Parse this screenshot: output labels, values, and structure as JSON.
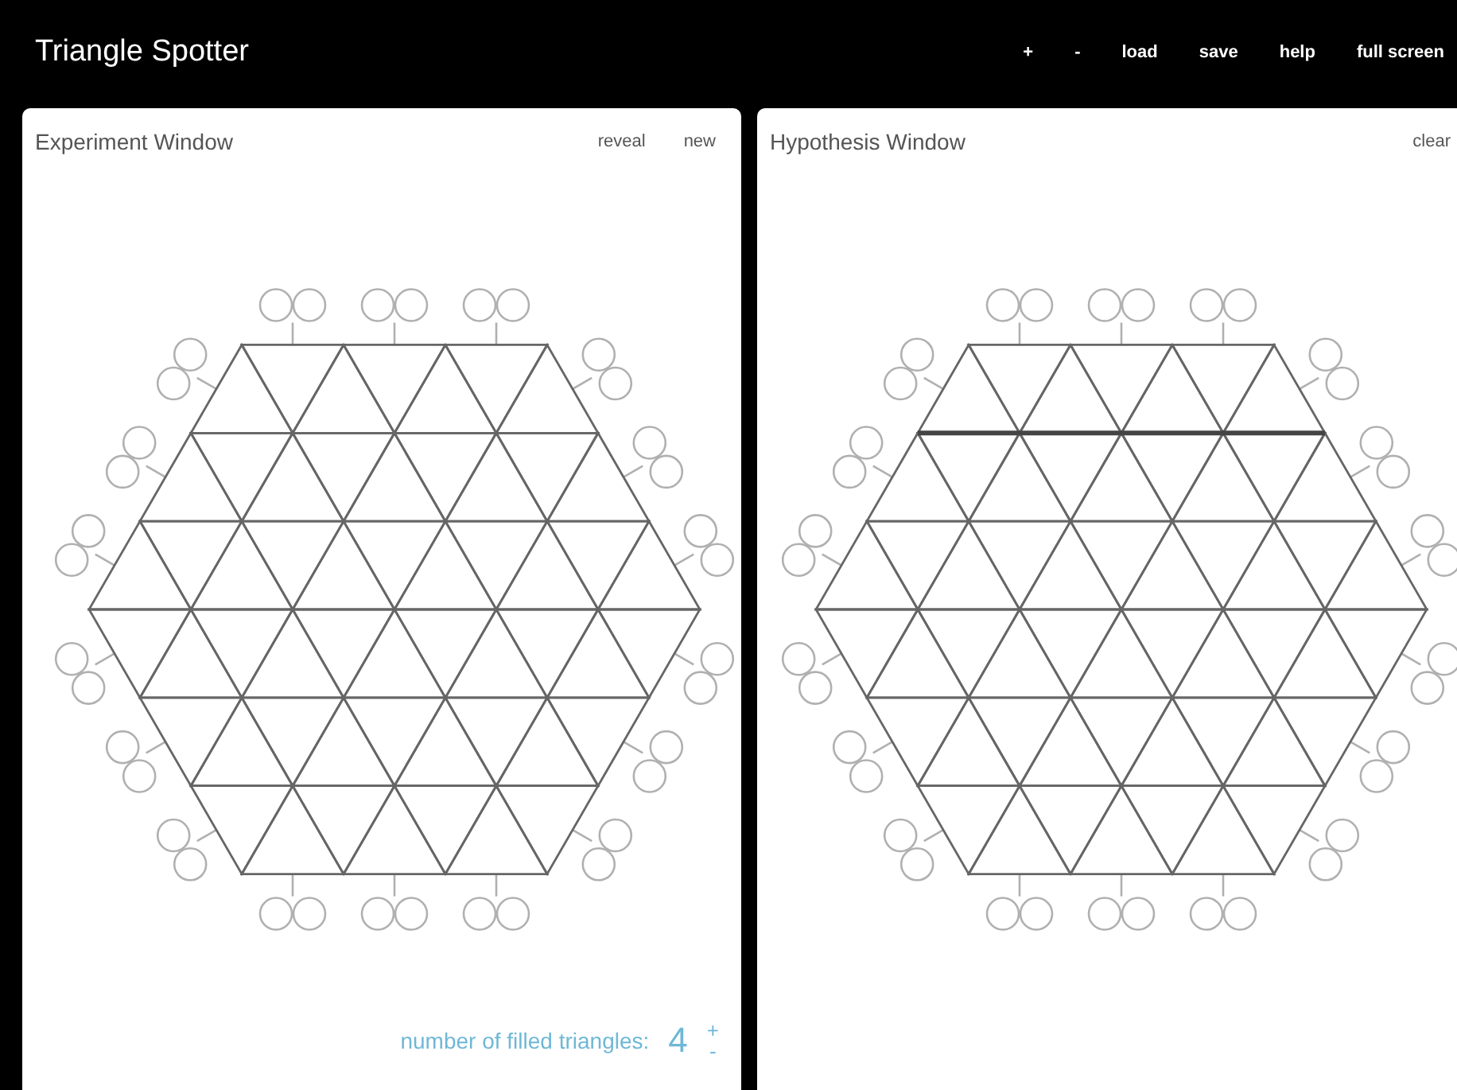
{
  "window": {
    "title": "Triangle Spotter"
  },
  "toolbar": [
    "+",
    "-",
    "load",
    "save",
    "help",
    "full screen"
  ],
  "panels": [
    {
      "kind": "experiment",
      "title": "Experiment Window",
      "actions": [
        "reveal",
        "new"
      ],
      "footer": {
        "label": "number of filled triangles:",
        "value": "4",
        "increment": "+",
        "decrement": "-"
      }
    },
    {
      "kind": "hypothesis",
      "title": "Hypothesis Window",
      "actions": [
        "clear"
      ]
    }
  ]
}
